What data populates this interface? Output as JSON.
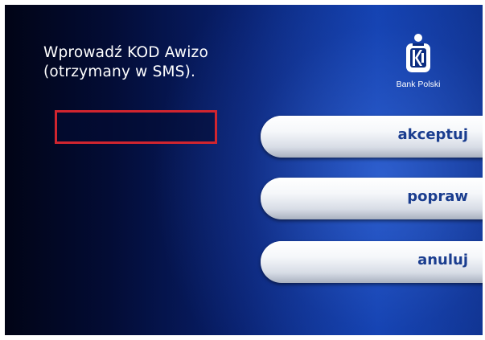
{
  "prompt": {
    "line1": "Wprowadź KOD Awizo",
    "line2": "(otrzymany w SMS)."
  },
  "code_input": {
    "value": "",
    "border_color": "#d0252f"
  },
  "logo": {
    "icon": "pko-piggybank-logo-icon",
    "text": "Bank Polski"
  },
  "buttons": {
    "accept": {
      "label": "akceptuj",
      "indicator_color": "#2e9e3a"
    },
    "correct": {
      "label": "popraw"
    },
    "cancel": {
      "label": "anuluj",
      "indicator_color": "#c8262e"
    }
  },
  "colors": {
    "label": "#1a3d8f",
    "background_dark": "#030c35",
    "background_light": "#1040b0"
  }
}
